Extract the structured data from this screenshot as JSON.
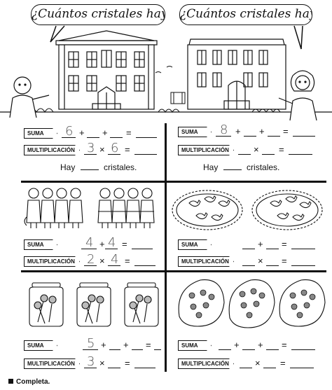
{
  "bubbles": {
    "left": "¿Cuántos cristales hay?",
    "right": "¿Cuántos cristales hay?"
  },
  "labels": {
    "suma": "SUMA",
    "multiplicacion": "MULTIPLICACIÓN",
    "plus": "+",
    "times": "×",
    "equals": "="
  },
  "sentence": {
    "hay": "Hay",
    "cristales": "cristales."
  },
  "exercises": {
    "e1": {
      "sum_first": "6",
      "mult_first": "3",
      "mult_second": "6"
    },
    "e2": {
      "sum_first": "8"
    },
    "e3": {
      "sum_first": "4",
      "sum_second": "4",
      "mult_first": "2",
      "mult_second": "4"
    },
    "e5": {
      "sum_first": "5",
      "mult_first": "3"
    }
  },
  "footer": {
    "instruction": "Completa."
  }
}
